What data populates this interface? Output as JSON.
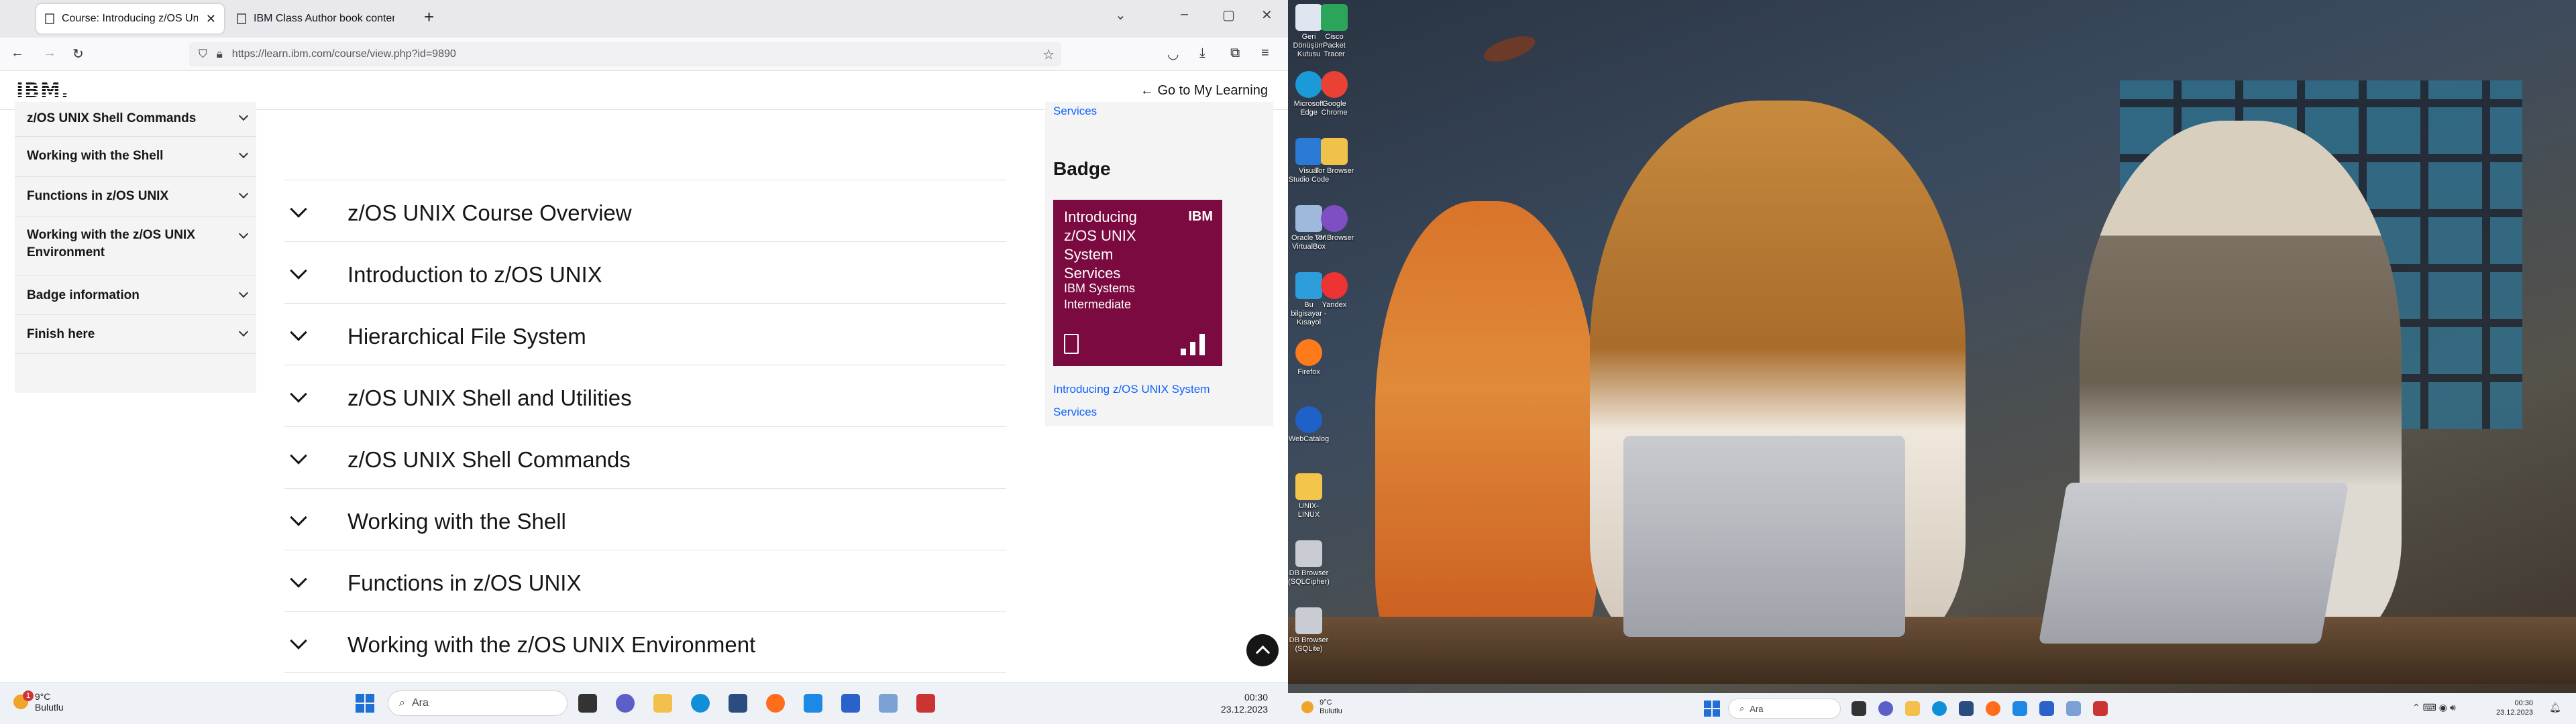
{
  "browser": {
    "tabs": [
      {
        "title": "Course: Introducing z/OS Unix",
        "active": true
      },
      {
        "title": "IBM Class Author book content - E",
        "active": false
      }
    ],
    "url": "https://learn.ibm.com/course/view.php?id=9890",
    "url_host": "ibm.com"
  },
  "header": {
    "logo": "IBM.",
    "back_link": "← Go to My Learning"
  },
  "course_index": [
    "z/OS UNIX Shell Commands",
    "Working with the Shell",
    "Functions in z/OS UNIX",
    "Working with the z/OS UNIX Environment",
    "Badge information",
    "Finish here"
  ],
  "sections": [
    "z/OS UNIX Course Overview",
    "Introduction to z/OS UNIX",
    "Hierarchical File System",
    "z/OS UNIX Shell and Utilities",
    "z/OS UNIX Shell Commands",
    "Working with the Shell",
    "Functions in z/OS UNIX",
    "Working with the z/OS UNIX Environment"
  ],
  "right_panel": {
    "top_link": "Services",
    "badge_heading": "Badge",
    "badge_card": {
      "title": "Introducing z/OS UNIX System Services",
      "brand": "IBM",
      "level_line1": "IBM Systems",
      "level_line2": "Intermediate"
    },
    "badge_link_line1": "Introducing z/OS UNIX System",
    "badge_link_line2": "Services"
  },
  "taskbar_left": {
    "weather_temp": "9°C",
    "weather_desc": "Bulutlu",
    "notification_count": "1",
    "search_placeholder": "Ara",
    "time": "00:30",
    "date": "23.12.2023"
  },
  "desktop_icons": [
    "Geri Dönüşüm Kutusu",
    "Cisco Packet Tracer",
    "Microsoft Edge",
    "Google Chrome",
    "Visual Studio Code",
    "Tor Browser",
    "Oracle VM VirtualBox",
    "Tor Browser",
    "Bu bilgisayar - Kısayol",
    "Yandex",
    "Firefox",
    "WebCatalog",
    "UNIX-LINUX",
    "DB Browser (SQLCipher)",
    "DB Browser (SQLite)"
  ],
  "taskbar_right": {
    "weather_temp": "9°C",
    "weather_desc": "Bulutlu",
    "search_placeholder": "Ara",
    "time": "00:30",
    "date": "23.12.2023"
  },
  "colors": {
    "ibm_blue": "#0f62fe",
    "badge_bg": "#7a0a3f",
    "text_dark": "#161616",
    "panel_bg": "#f4f4f4"
  }
}
